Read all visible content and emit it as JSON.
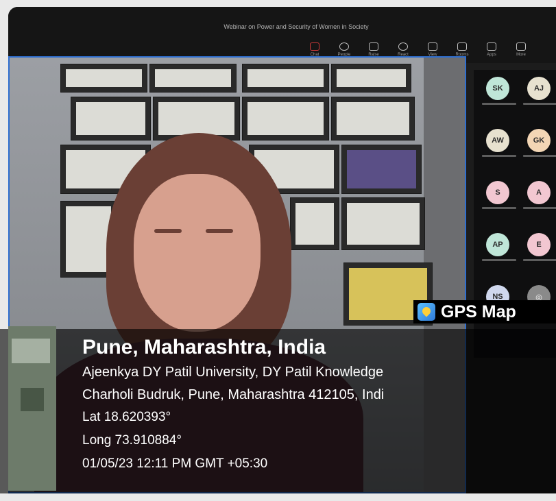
{
  "window": {
    "title": "Webinar on Power and Security of Women in Society"
  },
  "toolbar": {
    "items": [
      {
        "label": "Chat",
        "icon": "chat-icon"
      },
      {
        "label": "People",
        "icon": "people-icon"
      },
      {
        "label": "Raise",
        "icon": "raise-hand-icon"
      },
      {
        "label": "React",
        "icon": "react-icon"
      },
      {
        "label": "View",
        "icon": "view-icon"
      },
      {
        "label": "Rooms",
        "icon": "rooms-icon"
      },
      {
        "label": "Apps",
        "icon": "apps-icon"
      },
      {
        "label": "More",
        "icon": "more-icon"
      }
    ]
  },
  "participants": [
    {
      "initials": "SK",
      "color": "#bfe6d8"
    },
    {
      "initials": "AJ",
      "color": "#e7e1cf"
    },
    {
      "initials": "AW",
      "color": "#e7e1cf"
    },
    {
      "initials": "GK",
      "color": "#f3d6b5"
    },
    {
      "initials": "S",
      "color": "#f2c7d1"
    },
    {
      "initials": "A",
      "color": "#f2c7d1"
    },
    {
      "initials": "AP",
      "color": "#bfe6d8"
    },
    {
      "initials": "E",
      "color": "#f2c7d1"
    },
    {
      "initials": "NS",
      "color": "#d0d8ee"
    },
    {
      "initials": "",
      "color": "#8a8a8a"
    }
  ],
  "gps": {
    "brand": "GPS Map",
    "location": "Pune, Maharashtra, India",
    "address_line_1": "Ajeenkya DY Patil University, DY Patil Knowledge",
    "address_line_2": "Charholi Budruk, Pune, Maharashtra 412105, Indi",
    "lat": "Lat 18.620393°",
    "long": "Long 73.910884°",
    "datetime": "01/05/23 12:11 PM GMT +05:30"
  }
}
